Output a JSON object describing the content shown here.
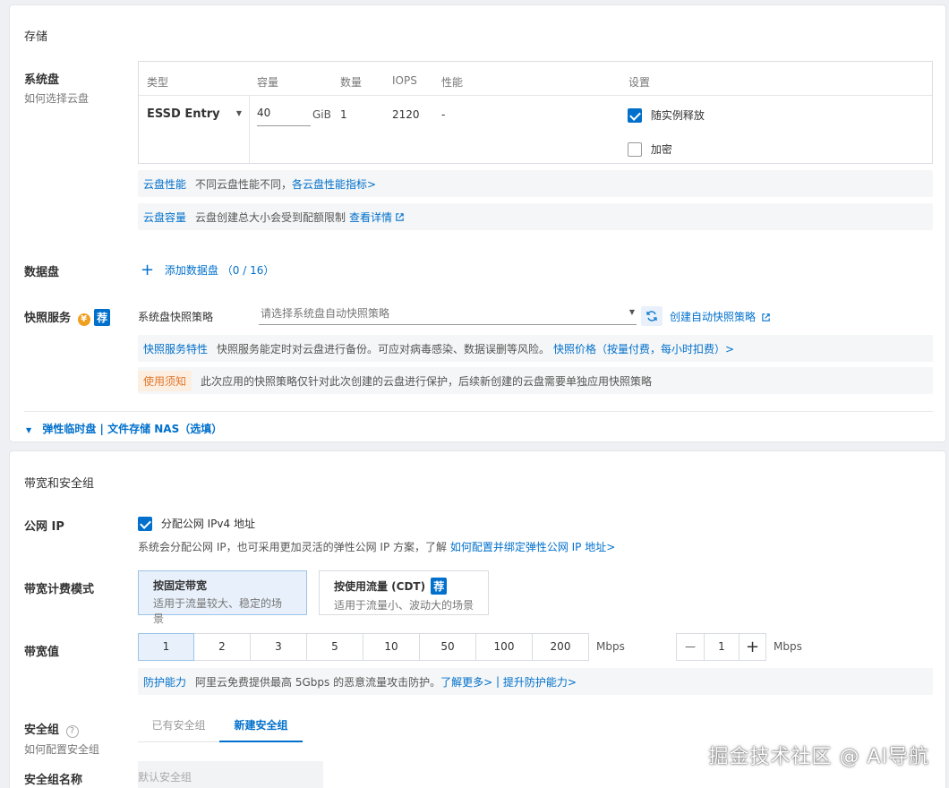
{
  "storage": {
    "section_title": "存储",
    "system_disk": {
      "label": "系统盘",
      "help_link": "如何选择云盘",
      "headers": {
        "type": "类型",
        "capacity": "容量",
        "count": "数量",
        "iops": "IOPS",
        "performance": "性能",
        "settings": "设置"
      },
      "type_value": "ESSD Entry",
      "capacity_value": "40",
      "capacity_unit": "GiB",
      "count_value": "1",
      "iops_value": "2120",
      "performance_value": "-",
      "release_with_instance": "随实例释放",
      "release_checked": true,
      "encrypt": "加密",
      "encrypt_checked": false
    },
    "perf_bar": {
      "tag": "云盘性能",
      "text": "不同云盘性能不同，",
      "link": "各云盘性能指标>"
    },
    "capacity_bar": {
      "tag": "云盘容量",
      "text": "云盘创建总大小会受到配额限制",
      "link": "查看详情"
    },
    "data_disk": {
      "label": "数据盘",
      "add_label": "添加数据盘",
      "count": "（0 / 16）"
    },
    "snapshot": {
      "label": "快照服务",
      "coin_icon": "¥",
      "badge": "荐",
      "policy_label": "系统盘快照策略",
      "policy_placeholder": "请选择系统盘自动快照策略",
      "create_link": "创建自动快照策略",
      "feature_tag": "快照服务特性",
      "feature_text": "快照服务能定时对云盘进行备份。可应对病毒感染、数据误删等风险。",
      "price_link": "快照价格（按量付费，每小时扣费）>",
      "notice_tag": "使用须知",
      "notice_text": "此次应用的快照策略仅针对此次创建的云盘进行保护，后续新创建的云盘需要单独应用快照策略"
    },
    "expand_link": "弹性临时盘 | 文件存储 NAS（选填）"
  },
  "network": {
    "section_title": "带宽和安全组",
    "public_ip": {
      "label": "公网 IP",
      "checkbox_label": "分配公网 IPv4 地址",
      "checked": true,
      "desc": "系统会分配公网 IP，也可采用更加灵活的弹性公网 IP 方案，了解",
      "link": "如何配置并绑定弹性公网 IP 地址>"
    },
    "billing": {
      "label": "带宽计费模式",
      "fixed_title": "按固定带宽",
      "fixed_sub": "适用于流量较大、稳定的场景",
      "traffic_title": "按使用流量 (CDT)",
      "traffic_badge": "荐",
      "traffic_sub": "适用于流量小、波动大的场景"
    },
    "bandwidth": {
      "label": "带宽值",
      "options": [
        "1",
        "2",
        "3",
        "5",
        "10",
        "50",
        "100",
        "200"
      ],
      "selected": "1",
      "unit": "Mbps",
      "stepper_minus": "—",
      "stepper_value": "1",
      "stepper_plus": "+",
      "stepper_unit": "Mbps"
    },
    "protection": {
      "tag": "防护能力",
      "text": "阿里云免费提供最高 5Gbps 的恶意流量攻击防护。",
      "link1": "了解更多>",
      "sep": " | ",
      "link2": "提升防护能力>"
    },
    "security_group": {
      "label": "安全组",
      "help_link": "如何配置安全组",
      "tab_existing": "已有安全组",
      "tab_new": "新建安全组",
      "name_label": "安全组名称",
      "name_placeholder": "默认安全组"
    }
  },
  "watermark": "掘金技术社区 @ AI导航"
}
